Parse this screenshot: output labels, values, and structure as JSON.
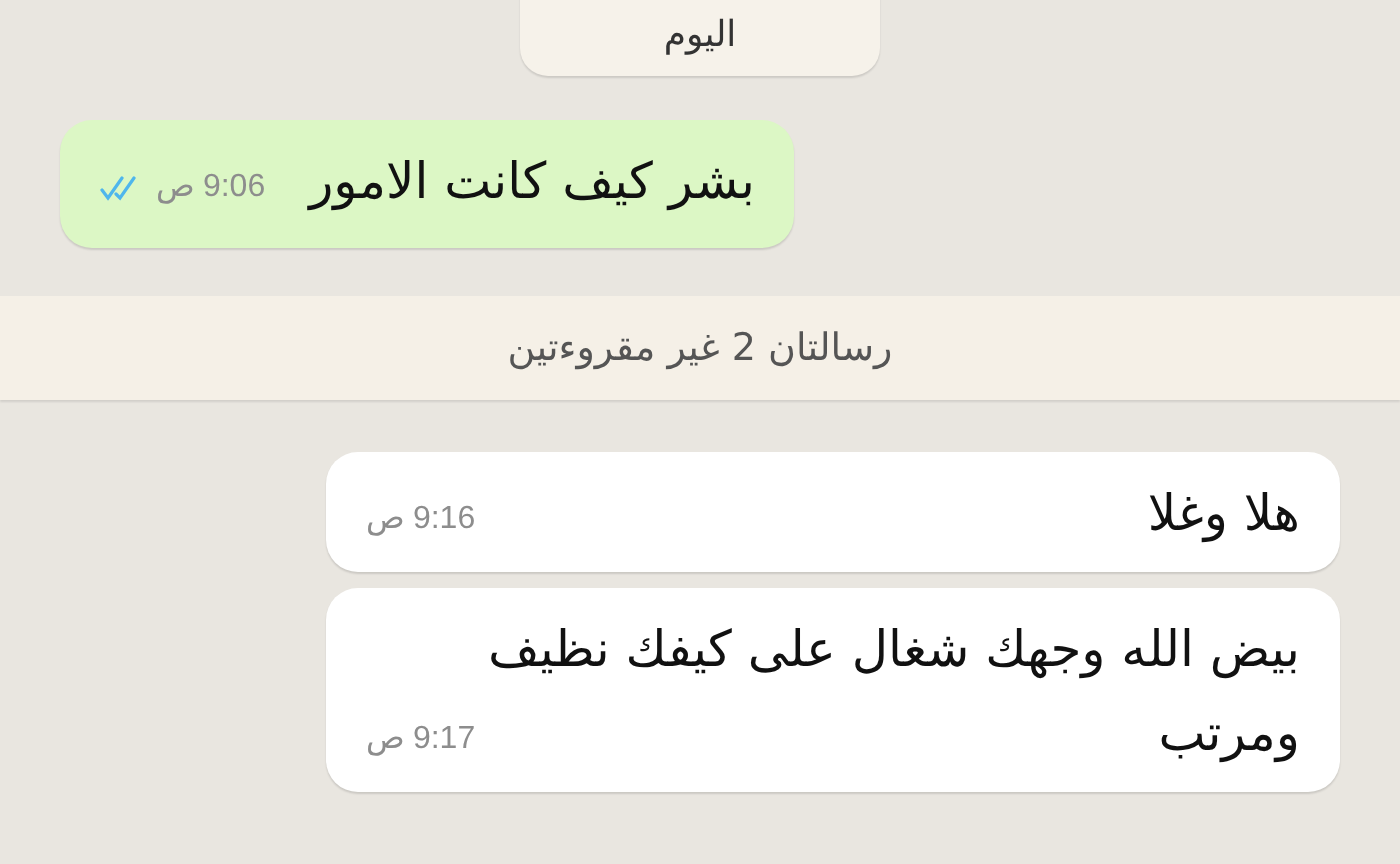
{
  "date_chip": "اليوم",
  "messages": [
    {
      "kind": "outgoing",
      "text": "بشر كيف كانت الامور",
      "time": "9:06 ص",
      "read": true
    },
    {
      "kind": "unread_banner",
      "text": "رسالتان 2 غير مقروءتين"
    },
    {
      "kind": "incoming",
      "text": "هلا وغلا",
      "time": "9:16 ص"
    },
    {
      "kind": "incoming",
      "text": "بيض الله وجهك شغال على كيفك نظيف ومرتب",
      "time": "9:17 ص"
    }
  ]
}
